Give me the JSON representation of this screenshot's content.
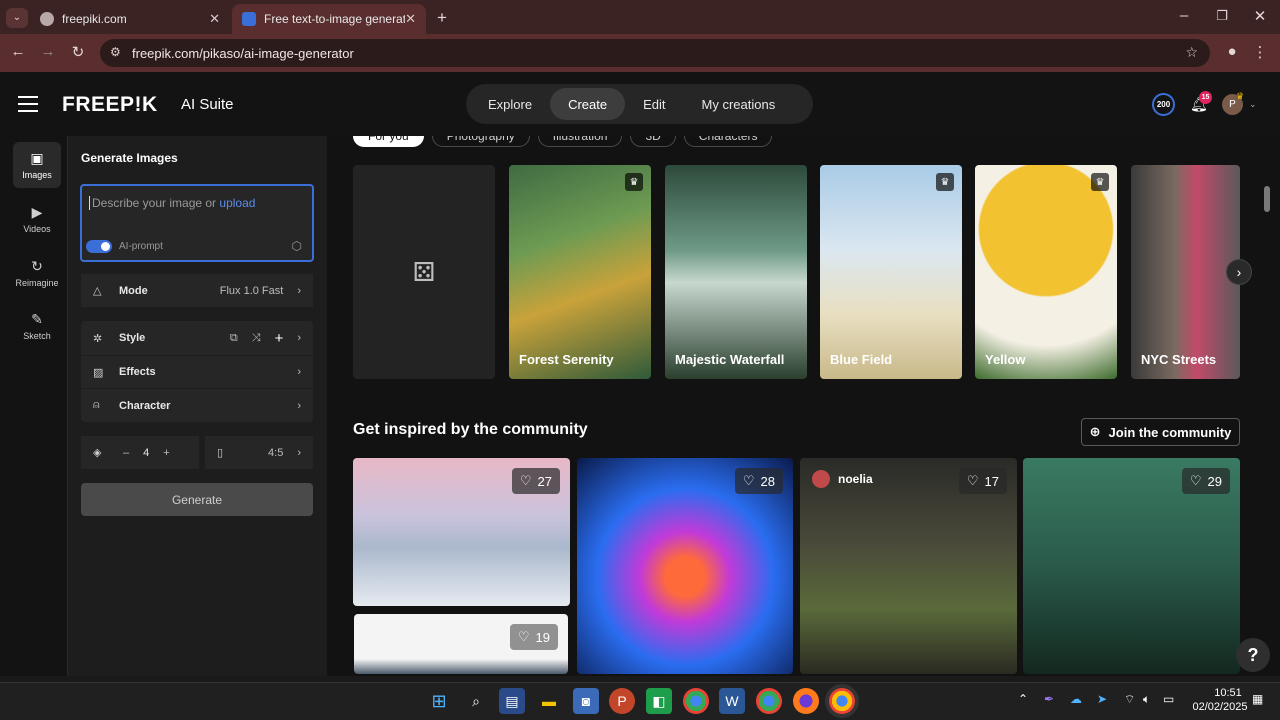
{
  "browser": {
    "tabs": [
      {
        "title": "freepiki.com",
        "active": false
      },
      {
        "title": "Free text-to-image generator | F",
        "active": true
      }
    ],
    "new_tab": "+",
    "url": "freepik.com/pikaso/ai-image-generator",
    "window_controls": {
      "minimize": "–",
      "maximize": "❐",
      "close": "✕"
    }
  },
  "header": {
    "logo": "FREEP!K",
    "suite": "AI Suite",
    "nav": [
      {
        "label": "Explore",
        "active": false
      },
      {
        "label": "Create",
        "active": true
      },
      {
        "label": "Edit",
        "active": false
      },
      {
        "label": "My creations",
        "active": false
      }
    ],
    "credits": "200",
    "notifications_count": "15",
    "avatar_letter": "P"
  },
  "rail": [
    {
      "label": "Images",
      "icon": "images-icon",
      "active": true
    },
    {
      "label": "Videos",
      "icon": "videos-icon",
      "active": false
    },
    {
      "label": "Reimagine",
      "icon": "reimagine-icon",
      "active": false
    },
    {
      "label": "Sketch",
      "icon": "sketch-icon",
      "active": false
    }
  ],
  "panel": {
    "title": "Generate Images",
    "prompt_placeholder": "Describe your image or ",
    "prompt_upload": "upload",
    "ai_prompt_label": "AI-prompt",
    "mode_label": "Mode",
    "mode_value": "Flux 1.0 Fast",
    "style_label": "Style",
    "effects_label": "Effects",
    "character_label": "Character",
    "count_minus": "–",
    "count_value": "4",
    "count_plus": "+",
    "aspect_value": "4:5",
    "generate_label": "Generate"
  },
  "styles": {
    "chips": [
      "For you",
      "Photography",
      "Illustration",
      "3D",
      "Characters"
    ],
    "cards": [
      {
        "label": "Forest Serenity",
        "premium": true
      },
      {
        "label": "Majestic Waterfall",
        "premium": false
      },
      {
        "label": "Blue Field",
        "premium": true
      },
      {
        "label": "Yellow",
        "premium": true
      },
      {
        "label": "NYC Streets",
        "premium": false
      }
    ]
  },
  "community": {
    "title": "Get inspired by the community",
    "join_label": "Join the community",
    "items": [
      {
        "likes": "27"
      },
      {
        "likes": "28"
      },
      {
        "likes": "17",
        "author": "noelia"
      },
      {
        "likes": "29"
      },
      {
        "likes": "19"
      }
    ]
  },
  "taskbar": {
    "time": "10:51",
    "date": "02/02/2025"
  },
  "help_label": "?"
}
